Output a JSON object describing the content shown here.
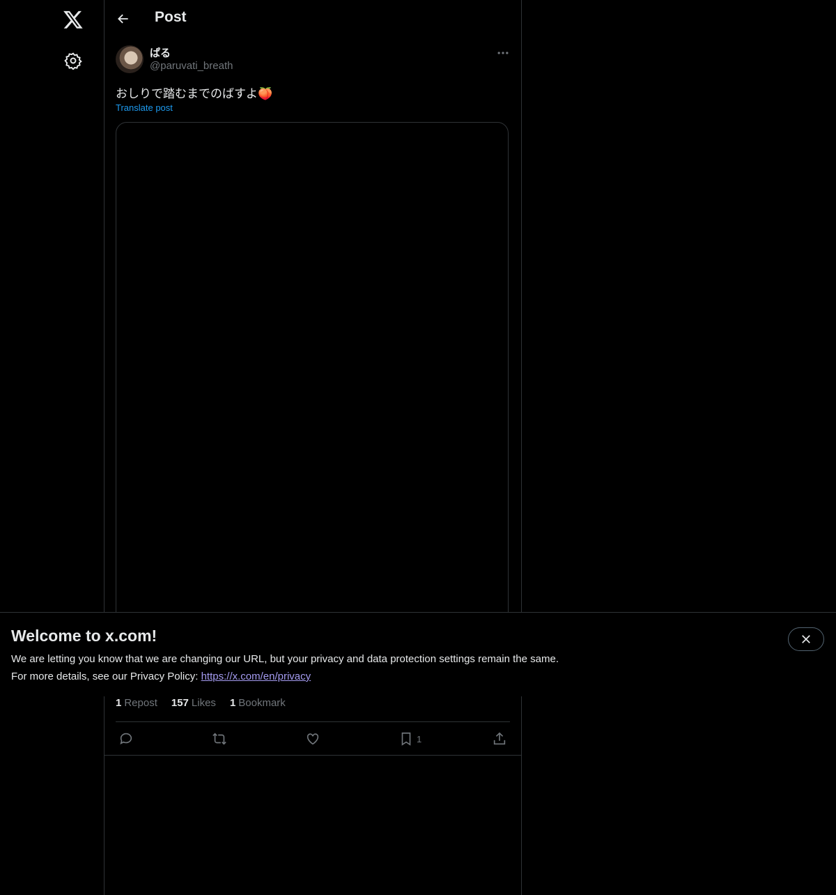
{
  "header": {
    "title": "Post"
  },
  "post": {
    "display_name": "ぱる",
    "handle": "@paruvati_breath",
    "text": "おしりで踏むまでのばすよ🍑",
    "translate_label": "Translate post"
  },
  "stats": {
    "reposts_count": "1",
    "reposts_label": "Repost",
    "likes_count": "157",
    "likes_label": "Likes",
    "bookmarks_count": "1",
    "bookmarks_label": "Bookmark"
  },
  "actions": {
    "bookmark_count": "1"
  },
  "banner": {
    "title": "Welcome to x.com!",
    "line1": "We are letting you know that we are changing our URL, but your privacy and data protection settings remain the same.",
    "line2_prefix": "For more details, see our Privacy Policy: ",
    "link": "https://x.com/en/privacy"
  },
  "colors": {
    "background": "#000000",
    "text": "#e7e9ea",
    "muted": "#71767b",
    "link": "#1d9bf0",
    "border": "#2f3336"
  },
  "icons": [
    "x-logo-icon",
    "gear-icon",
    "back-arrow-icon",
    "more-icon",
    "reply-icon",
    "repost-icon",
    "like-icon",
    "bookmark-icon",
    "share-icon",
    "close-icon"
  ]
}
